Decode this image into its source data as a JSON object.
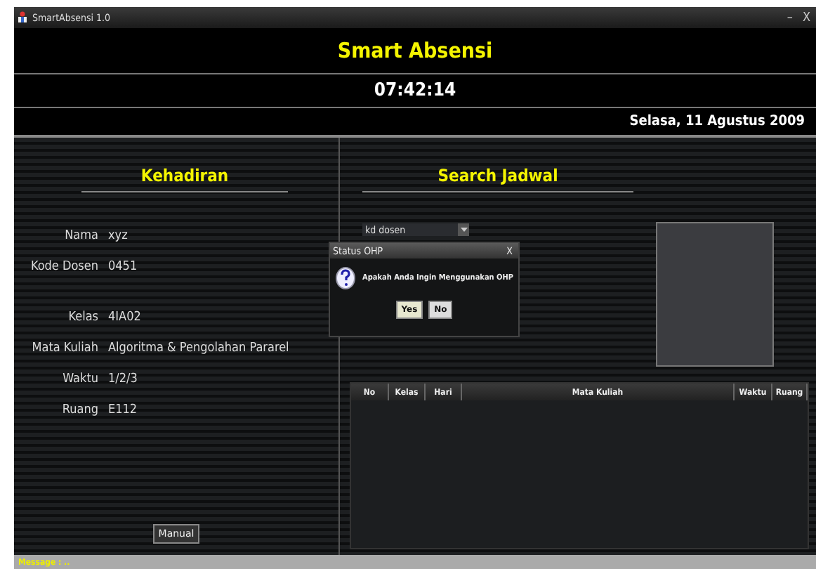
{
  "window": {
    "title": "SmartAbsensi 1.0",
    "controls": [
      "–",
      "X"
    ]
  },
  "header": {
    "title": "Smart Absensi",
    "time": "07:42:14",
    "date": "Selasa, 11 Agustus 2009"
  },
  "kehadiran": {
    "heading": "Kehadiran",
    "groups": [
      [
        {
          "label": "Nama",
          "value": "xyz"
        },
        {
          "label": "Kode Dosen",
          "value": "0451"
        }
      ],
      [
        {
          "label": "Kelas",
          "value": "4IA02"
        },
        {
          "label": "Mata Kuliah",
          "value": "Algoritma & Pengolahan Pararel"
        },
        {
          "label": "Waktu",
          "value": "1/2/3"
        },
        {
          "label": "Ruang",
          "value": "E112"
        }
      ]
    ],
    "button": "Manual"
  },
  "search_jadwal": {
    "heading": "Search Jadwal",
    "combo": "kd dosen",
    "table": {
      "columns": [
        "No",
        "Kelas",
        "Hari",
        "Mata Kuliah",
        "Waktu",
        "Ruang"
      ]
    }
  },
  "dialog": {
    "title": "Status OHP",
    "close": "X",
    "message": "Apakah Anda Ingin Menggunakan OHP",
    "buttons": [
      "Yes",
      "No"
    ]
  },
  "status_bar": "Message : .."
}
